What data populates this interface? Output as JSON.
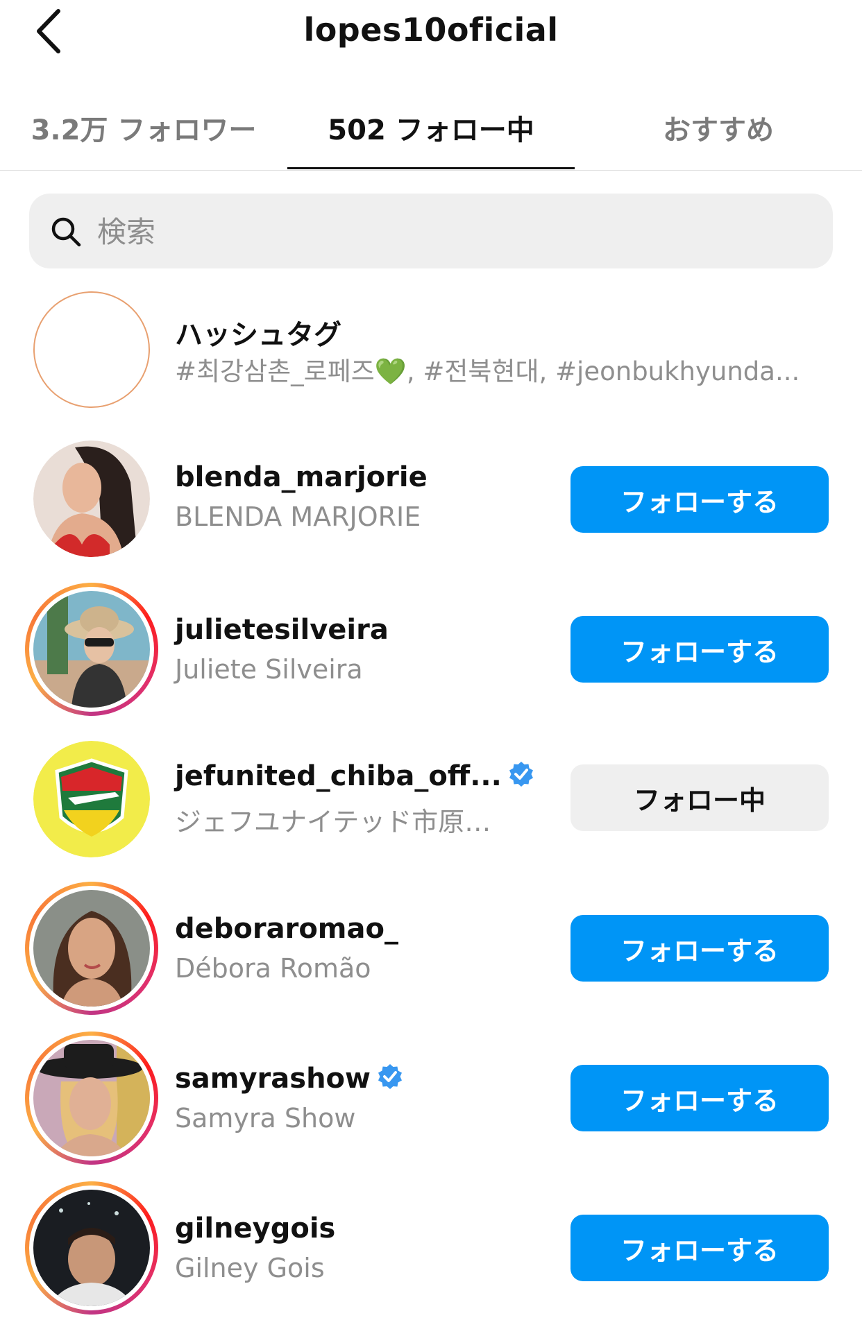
{
  "header": {
    "title": "lopes10oficial"
  },
  "tabs": [
    {
      "label": "3.2万 フォロワー",
      "active": false
    },
    {
      "label": "502 フォロー中",
      "active": true
    },
    {
      "label": "おすすめ",
      "active": false
    }
  ],
  "search": {
    "placeholder": "検索",
    "value": ""
  },
  "hashtags": {
    "title": "ハッシュタグ",
    "subtitle": "#최강삼촌_로페즈💚, #전북현대, #jeonbukhyunda..."
  },
  "users": [
    {
      "username": "blenda_marjorie",
      "fullname": "BLENDA MARJORIE",
      "button": "フォローする",
      "following": false,
      "verified": false
    },
    {
      "username": "julietesilveira",
      "fullname": "Juliete Silveira",
      "button": "フォローする",
      "following": false,
      "verified": false
    },
    {
      "username": "jefunited_chiba_off...",
      "fullname": "ジェフユナイテッド市原…",
      "button": "フォロー中",
      "following": true,
      "verified": true
    },
    {
      "username": "deboraromao_",
      "fullname": "Débora Romão",
      "button": "フォローする",
      "following": false,
      "verified": false
    },
    {
      "username": "samyrashow",
      "fullname": "Samyra Show",
      "button": "フォローする",
      "following": false,
      "verified": true
    },
    {
      "username": "gilneygois",
      "fullname": "Gilney Gois",
      "button": "フォローする",
      "following": false,
      "verified": false
    }
  ],
  "colors": {
    "accent": "#0095f6",
    "verified": "#3897f0",
    "secondary_text": "#8e8e8e"
  }
}
